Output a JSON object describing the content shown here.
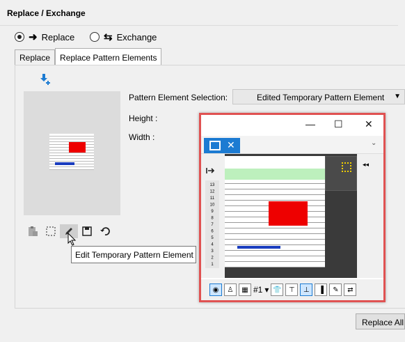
{
  "header": {
    "title": "Replace / Exchange"
  },
  "mode": {
    "replace_label": "Replace",
    "exchange_label": "Exchange",
    "selected": "replace"
  },
  "tabs": [
    {
      "label": "Replace"
    },
    {
      "label": "Replace Pattern Elements",
      "active": true
    }
  ],
  "fields": {
    "selection_label": "Pattern Element Selection:",
    "selection_value": "Edited Temporary Pattern Element",
    "height_label": "Height :",
    "width_label": "Width :"
  },
  "tooltip": {
    "text": "Edit Temporary Pattern Element"
  },
  "buttons": {
    "replace_all": "Replace All"
  },
  "floating_window": {
    "toolbar_select_value": "#1",
    "row_numbers": [
      "13",
      "12",
      "11",
      "10",
      "9",
      "8",
      "7",
      "6",
      "5",
      "4",
      "3",
      "2",
      "1"
    ]
  },
  "colors": {
    "accent": "#1c7bd2",
    "highlight_border": "#e05252",
    "pattern_red": "#e00000",
    "pattern_blue": "#1a3dbf",
    "green_row": "#bdf0bd"
  }
}
